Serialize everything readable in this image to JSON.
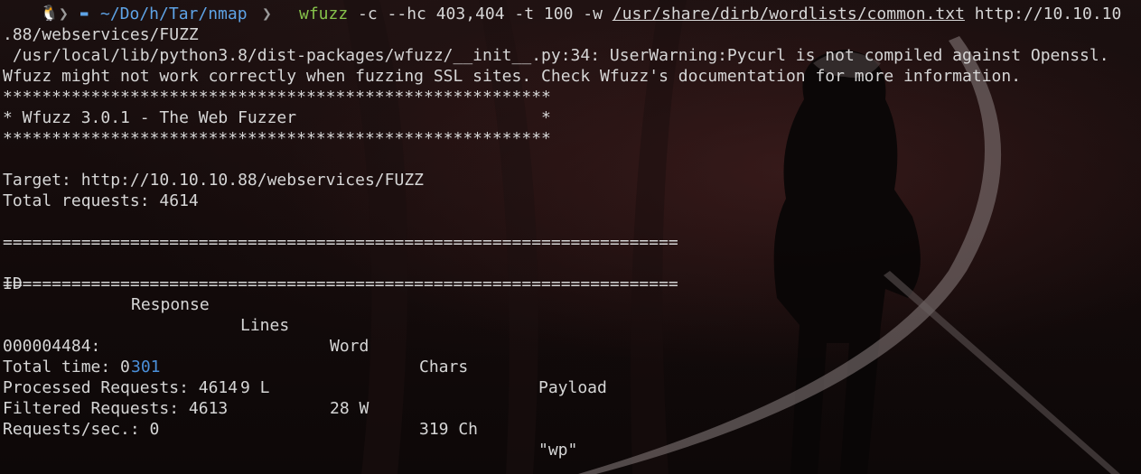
{
  "prompt": {
    "os_icon": "linux-icon",
    "os_glyph": "🐧",
    "separator": "❯",
    "folder_icon": "folder-icon",
    "folder_glyph": "▬",
    "cwd": "~/Do/h/Tar/nmap"
  },
  "command": {
    "name": "wfuzz",
    "args": " -c --hc 403,404 -t 100 -w ",
    "wordlist": "/usr/share/dirb/wordlists/common.txt",
    "url_part1": " http://10.10.10",
    "url_part2": ".88/webservices/FUZZ"
  },
  "output": {
    "warning_line1": " /usr/local/lib/python3.8/dist-packages/wfuzz/__init__.py:34: UserWarning:Pycurl is not compiled against Openssl.",
    "warning_line2": "Wfuzz might not work correctly when fuzzing SSL sites. Check Wfuzz's documentation for more information.",
    "stars_line": "********************************************************",
    "banner_line": "* Wfuzz 3.0.1 - The Web Fuzzer                         *",
    "target": "Target: http://10.10.10.88/webservices/FUZZ",
    "total_requests": "Total requests: 4614",
    "rule_line": "=====================================================================",
    "table": {
      "headers": [
        "ID",
        "Response",
        "Lines",
        "Word",
        "Chars",
        "Payload"
      ],
      "rows": [
        {
          "id": "000004484:",
          "response": "301",
          "lines": "9 L",
          "word": "28 W",
          "chars": "319 Ch",
          "payload": "\"wp\""
        }
      ]
    },
    "total_time": "Total time: 0",
    "processed": "Processed Requests: 4614",
    "filtered": "Filtered Requests: 4613",
    "rate": "Requests/sec.: 0"
  },
  "colors": {
    "command_name": "#86c24b",
    "path_blue": "#5ea3e6",
    "status_301": "#4a8fd9",
    "text": "#d6d6d6"
  }
}
